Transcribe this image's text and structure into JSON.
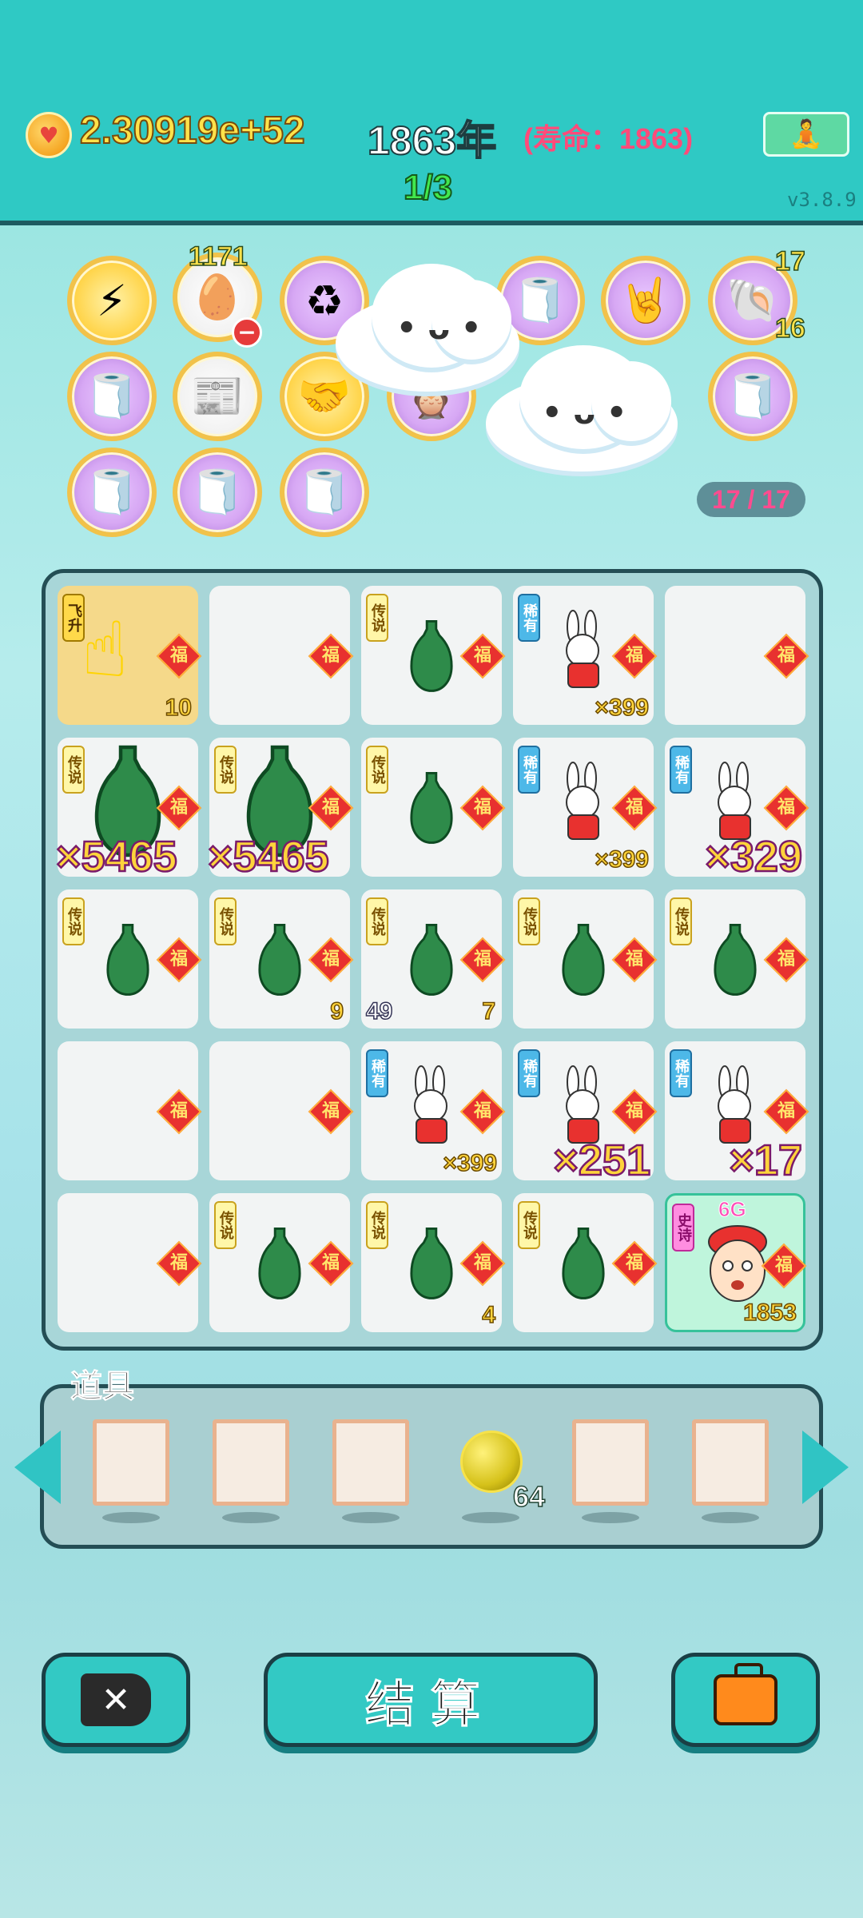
{
  "header": {
    "coins": "2.30919e+52",
    "year": "1863年",
    "lifespan": "(寿命：1863)",
    "progress": "1/3",
    "version": "v3.8.9"
  },
  "relics": {
    "egg_carton_count": "1171",
    "shell_top": "17",
    "shell_bottom": "16",
    "count_label": "17 / 17"
  },
  "board": {
    "tags": {
      "legend": "传说",
      "rare": "稀有",
      "epic": "史诗",
      "ascend": "飞升"
    },
    "fu": "福",
    "cells": [
      {
        "row": 1,
        "col": 1,
        "tag": "ascend",
        "label_num": "10"
      },
      {
        "row": 1,
        "col": 4,
        "tag": "rare",
        "mult": "×399"
      },
      {
        "row": 2,
        "col": 1,
        "tag": "legend",
        "mult": "×5465"
      },
      {
        "row": 2,
        "col": 2,
        "tag": "legend",
        "mult": "×5465"
      },
      {
        "row": 2,
        "col": 4,
        "tag": "rare",
        "mult": "×399"
      },
      {
        "row": 2,
        "col": 5,
        "tag": "rare",
        "mult": "×329"
      },
      {
        "row": 3,
        "col": 2,
        "tag": "legend",
        "num": "9"
      },
      {
        "row": 3,
        "col": 3,
        "tag": "legend",
        "num_left": "49",
        "num": "7"
      },
      {
        "row": 4,
        "col": 3,
        "tag": "rare",
        "mult": "×399"
      },
      {
        "row": 4,
        "col": 4,
        "tag": "rare",
        "mult": "×251"
      },
      {
        "row": 4,
        "col": 5,
        "tag": "rare",
        "mult": "×17"
      },
      {
        "row": 5,
        "col": 3,
        "tag": "legend",
        "num": "4"
      },
      {
        "row": 5,
        "col": 5,
        "tag": "epic",
        "top": "6G",
        "num": "1853"
      }
    ]
  },
  "items": {
    "label": "道具",
    "ball_count": "64"
  },
  "buttons": {
    "settle": "结算"
  }
}
